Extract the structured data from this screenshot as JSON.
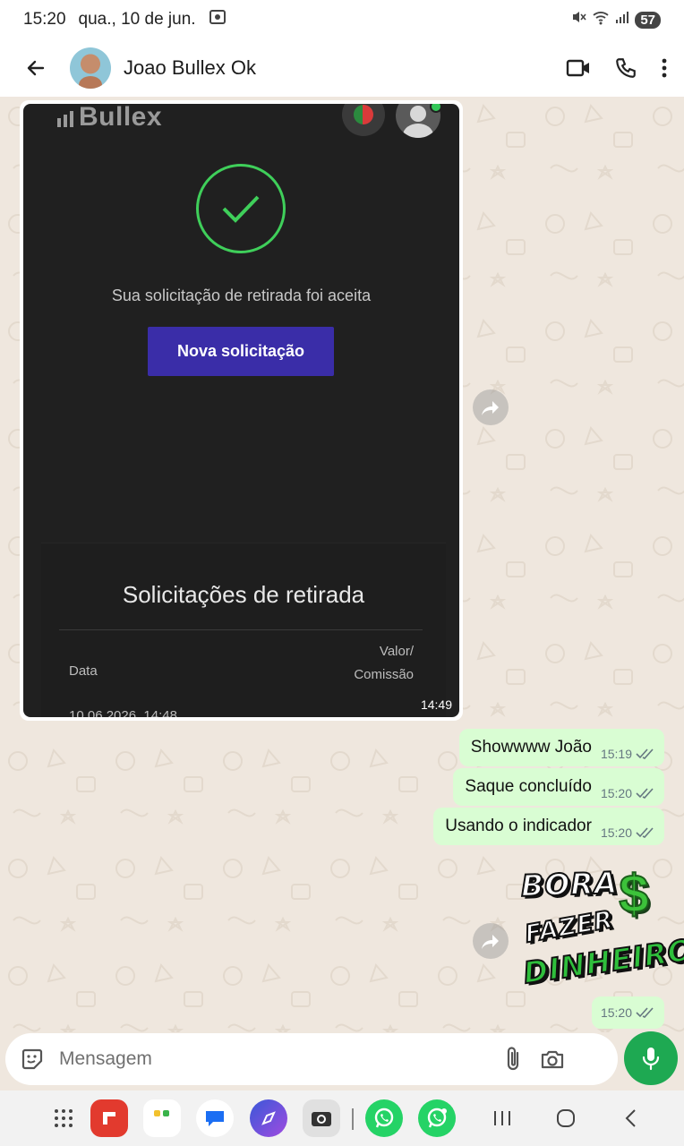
{
  "status_bar": {
    "time": "15:20",
    "date": "qua., 10 de jun.",
    "battery": "57"
  },
  "header": {
    "contact_name": "Joao Bullex Ok"
  },
  "image_message": {
    "brand": "Bullex",
    "accept_text": "Sua solicitação de retirada foi aceita",
    "button_label": "Nova solicitação",
    "panel_title": "Solicitações de retirada",
    "col_date": "Data",
    "col_value_1": "Valor/",
    "col_value_2": "Comissão",
    "row_date": "10.06.2026, 14:48",
    "time": "14:49"
  },
  "messages": [
    {
      "text": "Showwww João",
      "time": "15:19"
    },
    {
      "text": "Saque concluído",
      "time": "15:20"
    },
    {
      "text": "Usando o indicador",
      "time": "15:20"
    }
  ],
  "sticker": {
    "line1": "BORA",
    "line2": "FAZER",
    "line3": "DINHEIRO",
    "dollar": "$",
    "time": "15:20"
  },
  "input": {
    "placeholder": "Mensagem"
  },
  "colors": {
    "outgoing_bubble": "#d9fdd3",
    "chat_background": "#efe7de",
    "mic_button": "#1ea952",
    "read_ticks": "#53bdeb"
  }
}
